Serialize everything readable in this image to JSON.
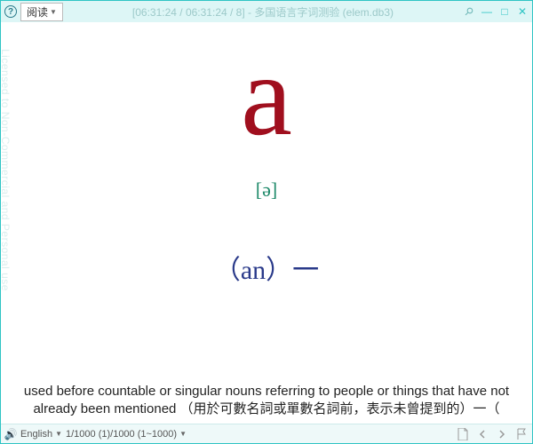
{
  "titlebar": {
    "mode_label": "阅读",
    "title_text": "[06:31:24 / 06:31:24 / 8] - 多国语言字词测验 (elem.db3)"
  },
  "watermark": "Licensed to Non-Commercial and Personal use",
  "card": {
    "word": "a",
    "phonetic": "[ə]",
    "alternate": "（an）一",
    "definition": "used before countable or singular nouns referring to people or things that have not already been mentioned （用於可數名詞或單數名詞前，表示未曾提到的）一（"
  },
  "statusbar": {
    "language": "English",
    "range": "1/1000 (1)/1000 (1~1000)"
  }
}
